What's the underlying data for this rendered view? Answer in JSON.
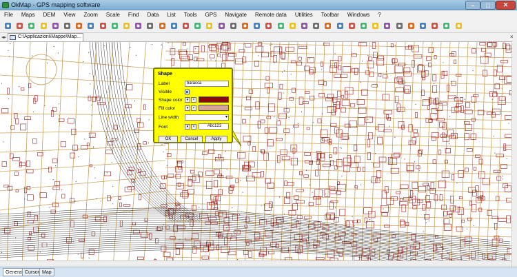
{
  "window": {
    "title": "OkMap - GPS mapping software",
    "minimize": "–",
    "maximize": "□",
    "close": "✕"
  },
  "menu": [
    "File",
    "Maps",
    "DEM",
    "View",
    "Zoom",
    "Scale",
    "Find",
    "Data",
    "List",
    "Tools",
    "GPS",
    "Navigate",
    "Remote data",
    "Utilities",
    "Toolbar",
    "Windows",
    "?"
  ],
  "toolbar_icons": [
    "open-map-icon",
    "undo-icon",
    "redo-icon",
    "find-icon",
    "toggle-icon",
    "print-icon",
    "save-icon",
    "copy-icon",
    "layers-icon",
    "paste-icon",
    "image-icon",
    "zoom-icon",
    "zoom-in-icon",
    "zoom-out-icon",
    "zoom-region-icon",
    "zoom-reset-icon",
    "waypoint-tool-icon",
    "route-tool-icon",
    "track-tool-icon",
    "measure-icon",
    "edit-points-icon",
    "shape-tool-icon",
    "edit-shape-icon",
    "select-arrow-icon",
    "pan-icon",
    "gps-icon",
    "download-icon",
    "rotate-icon",
    "lasso-icon",
    "polyline-icon",
    "diamond-icon",
    "move-icon",
    "add-node-icon",
    "pencil-icon",
    "ruler-icon",
    "flag-icon",
    "export-icon",
    "import-icon",
    "tools-icon"
  ],
  "document_tab": {
    "label": "C:\\Applicazioni\\Mappe\\Map...",
    "close": "×",
    "nav": "◂▸"
  },
  "dialog": {
    "title": "Shape",
    "label_label": "Label",
    "label_value": "baracca",
    "visible_label": "Visible",
    "visible_checked": true,
    "shape_color_label": "Shape color",
    "shape_color": "#8b0a0a",
    "fill_color_label": "Fill color",
    "fill_color": "#d7a49a",
    "line_width_label": "Line width",
    "line_width_value": "",
    "font_label": "Font",
    "font_preview": "Abc123",
    "ok": "OK",
    "cancel": "Cancel",
    "apply": "Apply"
  },
  "bottom_tabs": [
    "General",
    "Cursor",
    "Map"
  ],
  "colors": {
    "road": "#c9a05a",
    "building": "#9b1c1c",
    "rail": "#3a3a3a",
    "dialog": "#ffff00"
  }
}
